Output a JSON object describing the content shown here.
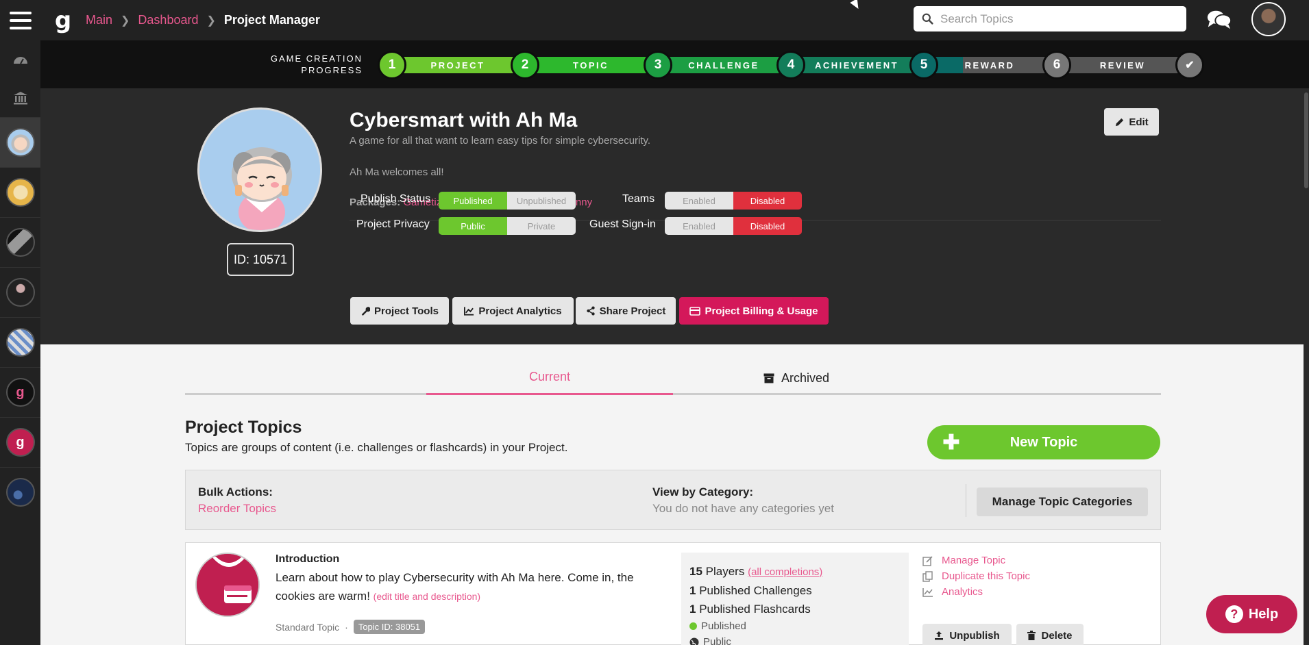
{
  "breadcrumbs": {
    "main": "Main",
    "dashboard": "Dashboard",
    "current": "Project Manager"
  },
  "logo": "g",
  "search": {
    "placeholder": "Search Topics"
  },
  "progress": {
    "label_line1": "GAME CREATION",
    "label_line2": "PROGRESS",
    "steps": [
      {
        "num": "1",
        "label": "PROJECT",
        "color": "#6dc72e"
      },
      {
        "num": "2",
        "label": "TOPIC",
        "color": "#2db82d"
      },
      {
        "num": "3",
        "label": "CHALLENGE",
        "color": "#1c9e43"
      },
      {
        "num": "4",
        "label": "ACHIEVEMENT",
        "color": "#137d5a"
      },
      {
        "num": "5",
        "label": "REWARD",
        "color": "#0a6a66"
      },
      {
        "num": "6",
        "label": "REVIEW",
        "color": "#666666"
      }
    ],
    "done_mark": "✔"
  },
  "project": {
    "title": "Cybersmart with Ah Ma",
    "subtitle": "A game for all that want to learn easy tips for simple cybersecurity.",
    "welcome": "Ah Ma welcomes all!",
    "packages_label": "Packages:",
    "package_1": "Gametize Showcase",
    "package_sep": "|",
    "package_2": "Learn With Granny",
    "id_label": "ID: 10571",
    "edit_label": "Edit",
    "settings": {
      "publish_status": {
        "label": "Publish Status",
        "on": "Published",
        "off": "Unpublished"
      },
      "privacy": {
        "label": "Project Privacy",
        "on": "Public",
        "off": "Private"
      },
      "teams": {
        "label": "Teams",
        "enabled": "Enabled",
        "disabled": "Disabled"
      },
      "guest": {
        "label": "Guest Sign-in",
        "enabled": "Enabled",
        "disabled": "Disabled"
      }
    },
    "tools": {
      "tools": "Project Tools",
      "analytics": "Project Analytics",
      "share": "Share Project",
      "billing": "Project Billing & Usage"
    }
  },
  "tabs": {
    "current": "Current",
    "archived": "Archived"
  },
  "topics": {
    "title": "Project Topics",
    "description": "Topics are groups of content (i.e. challenges or flashcards) in your Project.",
    "new_topic": "New Topic",
    "bulk_actions": "Bulk Actions:",
    "reorder": "Reorder Topics",
    "view_by_category": "View by Category:",
    "no_categories": "You do not have any categories yet",
    "manage_categories": "Manage Topic Categories",
    "items": [
      {
        "title": "Introduction",
        "description": "Learn about how to play Cybersecurity with Ah Ma here. Come in, the cookies are warm!",
        "edit_link": "(edit title and description)",
        "type": "Standard Topic",
        "type_sep": "·",
        "id_badge": "Topic ID: 38051",
        "players_count": "15",
        "players_label": "Players",
        "all_completions": "(all completions)",
        "challenges_count": "1",
        "challenges_label": "Published Challenges",
        "flashcards_count": "1",
        "flashcards_label": "Published Flashcards",
        "status": "Published",
        "privacy": "Public",
        "actions": {
          "manage": "Manage Topic",
          "duplicate": "Duplicate this Topic",
          "analytics": "Analytics"
        },
        "unpublish": "Unpublish",
        "delete": "Delete"
      }
    ]
  },
  "help": {
    "label": "Help",
    "icon": "?"
  },
  "colors": {
    "accent": "#e8588e",
    "green": "#6dc72e",
    "red": "#e0303d",
    "billing": "#d4185a",
    "help": "#c01f50"
  }
}
